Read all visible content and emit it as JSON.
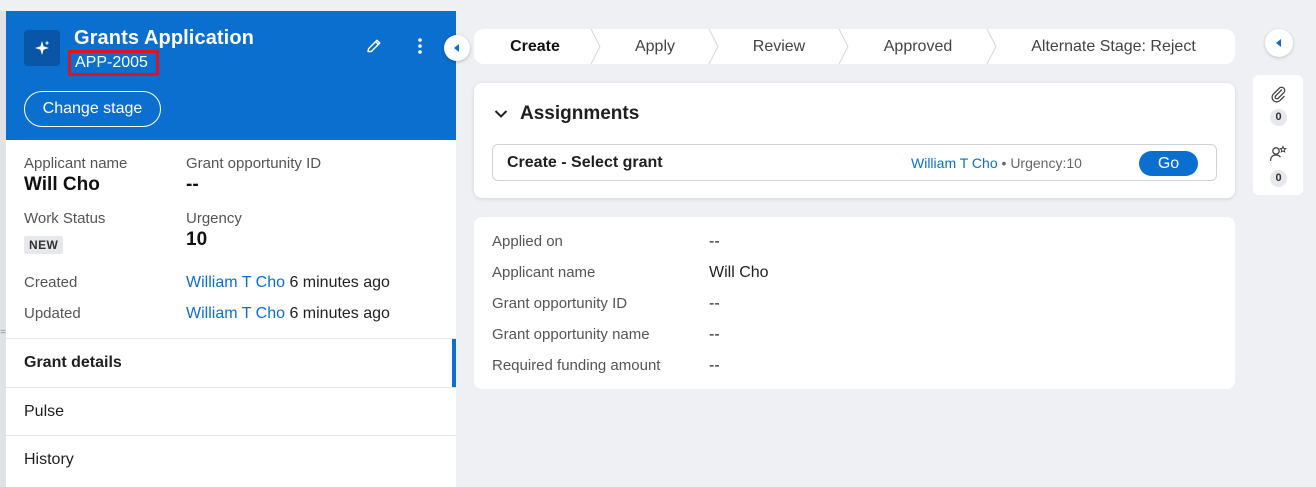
{
  "case": {
    "title": "Grants Application",
    "id": "APP-2005",
    "change_stage_label": "Change stage"
  },
  "summary": {
    "applicant_label": "Applicant name",
    "applicant_value": "Will Cho",
    "grant_id_label": "Grant opportunity ID",
    "grant_id_value": "--",
    "work_status_label": "Work Status",
    "work_status_value": "NEW",
    "urgency_label": "Urgency",
    "urgency_value": "10",
    "created_label": "Created",
    "created_by": "William T Cho",
    "created_when": "6 minutes ago",
    "updated_label": "Updated",
    "updated_by": "William T Cho",
    "updated_when": "6 minutes ago"
  },
  "nav": [
    {
      "label": "Grant details",
      "active": true
    },
    {
      "label": "Pulse",
      "active": false
    },
    {
      "label": "History",
      "active": false
    }
  ],
  "stages": [
    {
      "label": "Create",
      "current": true
    },
    {
      "label": "Apply",
      "current": false
    },
    {
      "label": "Review",
      "current": false
    },
    {
      "label": "Approved",
      "current": false
    },
    {
      "label": "Alternate Stage: Reject",
      "current": false
    }
  ],
  "assignments": {
    "heading": "Assignments",
    "item_name": "Create - Select grant",
    "assignee": "William T Cho",
    "separator": " • ",
    "urgency": "Urgency:10",
    "go_label": "Go"
  },
  "details": [
    {
      "label": "Applied on",
      "value": "--"
    },
    {
      "label": "Applicant name",
      "value": "Will Cho"
    },
    {
      "label": "Grant opportunity ID",
      "value": "--"
    },
    {
      "label": "Grant opportunity name",
      "value": "--"
    },
    {
      "label": "Required funding amount",
      "value": "--"
    }
  ],
  "rail": {
    "attachments_count": "0",
    "followers_count": "0"
  },
  "icons": {
    "app": "sparkle-icon",
    "edit": "pencil-icon",
    "more": "more-vertical-icon",
    "collapse": "caret-left-icon",
    "attachments": "paperclip-icon",
    "followers": "user-star-icon"
  },
  "colors": {
    "brand": "#0b6fcf",
    "highlight": "#e1141b"
  }
}
